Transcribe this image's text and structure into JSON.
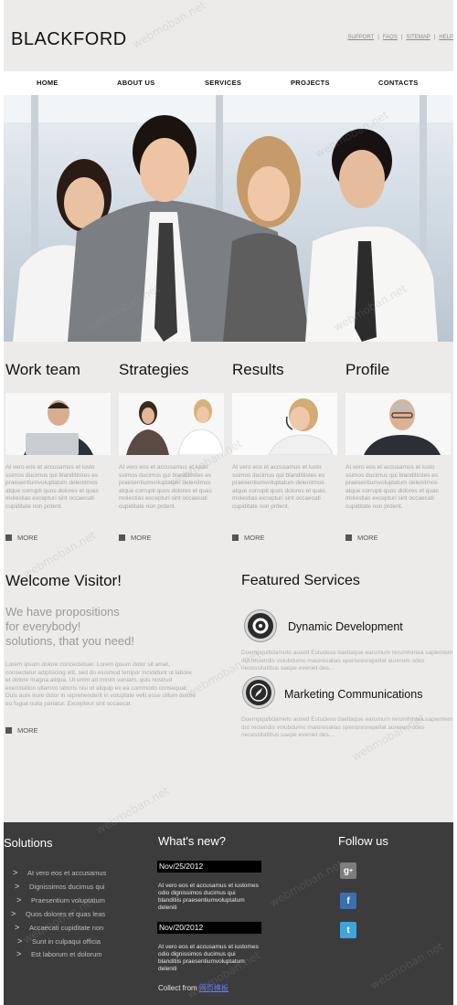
{
  "header": {
    "logo": "BLACKFORD",
    "toplinks": [
      "SUPPORT",
      "FAQS",
      "SITEMAP",
      "HELP"
    ]
  },
  "nav": [
    "HOME",
    "ABOUT US",
    "SERVICES",
    "PROJECTS",
    "CONTACTS"
  ],
  "features": [
    {
      "title": "Work team",
      "text": "At vero eos et accusamus et iusto ssimos ducimus qui blanditiistes es praesentiumvoluptatum delenitmos atque corrupti quos dolores et quas molestias excepturi sint occaecati cupiditate non prdent.",
      "more": "MORE"
    },
    {
      "title": "Strategies",
      "text": "At vero eos et accusamus et iusto ssimos ducimus qui blanditiistes es praesentiumvoluptatum delenitmos atque corrupti quos dolores et quas molestias excepturi sint occaecati cupiditate non prdent.",
      "more": "MORE"
    },
    {
      "title": "Results",
      "text": "At vero eos et accusamus et iusto ssimos ducimus qui blanditiistes es praesentiumvoluptatum delenitmos atque corrupti quos dolores et quas molestias excepturi sint occaecati cupiditate non prdent.",
      "more": "MORE"
    },
    {
      "title": "Profile",
      "text": "At vero eos et accusamus et iusto ssimos ducimus qui blanditiistes es praesentiumvoluptatum delenitmos atque corrupti quos dolores et quas molestias excepturi sint occaecati cupiditate non prdent.",
      "more": "MORE"
    }
  ],
  "welcome": {
    "title": "Welcome Visitor!",
    "lead_lines": [
      "We have propositions",
      "for everybody!",
      "solutions, that you need!"
    ],
    "text": "Lorem ipsum dolore concectetuer. Lorem ipsum dolor sit amet, consectetur adipisicing elit, sed do eiusmod tempor incididunt ut labore et dolore magna aliqua. Ut enim ad minim veniam, quis nostrud exercitation ullamco laboris nisi ut aliquip ex ea commodo consequat. Duis aute irure dolor in reprehenderit in voluptate velit esse cillum dolore eu fugiat nulla pariatur. Excepteur sint occaecat.",
    "more": "MORE"
  },
  "featured": {
    "title": "Featured Services",
    "items": [
      {
        "name": "Dynamic Development",
        "text": "Duempquibdamoto aused Estudesu daeltaque earumum rerumhintea sapientem dut reciendis volubdumo maioresalias sperioresrepellat aurerum odes necessitatibus saepe eveniet des..."
      },
      {
        "name": "Marketing Communications",
        "text": "Duempquibdameto aused Estudesu daeltaque earumum rerumhintea sapientem dut reciendis volubdumo maioresalias sperioresrepellat aurerum odes necessitatibus saepe eveniet des..."
      }
    ]
  },
  "footer": {
    "solutions_title": "Solutions",
    "solutions": [
      "At vero eos et accusamus",
      "Dignissimos ducimus qui",
      "Praesentium voluptatum",
      "Quos dolores et quas leas",
      "Accaecati cupiditate non",
      "Sunt in culpaqui officia",
      "Est laborum et dolorum"
    ],
    "news_title": "What's new?",
    "news": [
      {
        "date": "Nov/25/2012",
        "text": "At vero eos et accusamus et iustomes odio dignissimos ducimus qui blanditiis praesentiumvoluptatum deleniti"
      },
      {
        "date": "Nov/20/2012",
        "text": "At vero eos et accusamus et iustomes odio dignissimos ducimus qui blanditiis praesentiumvoluptatum deleniti"
      }
    ],
    "collect_label": "Collect from",
    "collect_link": "网页模板",
    "follow_title": "Follow us",
    "social_icons": [
      "google-plus-icon",
      "delicious-icon",
      "twitter-icon"
    ]
  },
  "watermark": "webmoban.net",
  "colors": {
    "page_bg": "#ecebea",
    "footer_bg": "#3c3c3c",
    "date_bar": "#000000",
    "link": "#5c7cff"
  }
}
